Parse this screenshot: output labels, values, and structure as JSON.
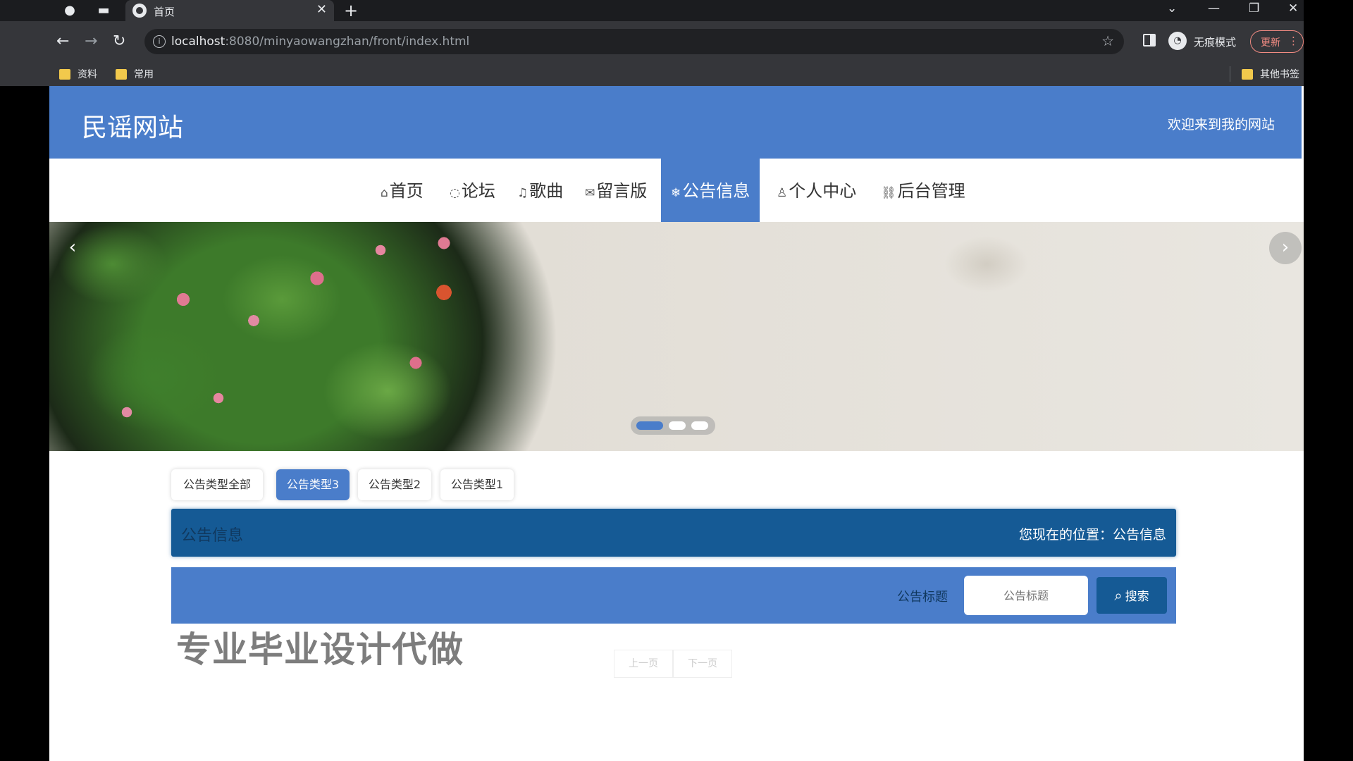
{
  "browser": {
    "tab_title": "首页",
    "url_host": "localhost",
    "url_rest": ":8080/minyaowangzhan/front/index.html",
    "incognito_label": "无痕模式",
    "update_label": "更新",
    "bookmarks": [
      "资料",
      "常用"
    ],
    "other_bookmarks": "其他书签"
  },
  "site": {
    "title": "民谣网站",
    "welcome": "欢迎来到我的网站",
    "nav": [
      {
        "label": "首页",
        "icon": "home-icon"
      },
      {
        "label": "论坛",
        "icon": "forum-icon"
      },
      {
        "label": "歌曲",
        "icon": "music-icon"
      },
      {
        "label": "留言版",
        "icon": "mail-icon"
      },
      {
        "label": "公告信息",
        "icon": "snowflake-icon",
        "active": true
      },
      {
        "label": "个人中心",
        "icon": "user-icon"
      },
      {
        "label": "后台管理",
        "icon": "link-icon"
      }
    ],
    "accent_color": "#4a7dca",
    "dark_color": "#155a95"
  },
  "banner": {
    "slide_count": 3,
    "active_slide": 1
  },
  "filters": {
    "types": [
      "公告类型全部",
      "公告类型3",
      "公告类型2",
      "公告类型1"
    ],
    "active_index": 1
  },
  "crumb": {
    "title": "公告信息",
    "location": "您现在的位置：公告信息"
  },
  "search": {
    "label": "公告标题",
    "placeholder": "公告标题",
    "button": "搜索"
  },
  "watermark": "专业毕业设计代做",
  "pagination": {
    "prev": "上一页",
    "next": "下一页"
  }
}
